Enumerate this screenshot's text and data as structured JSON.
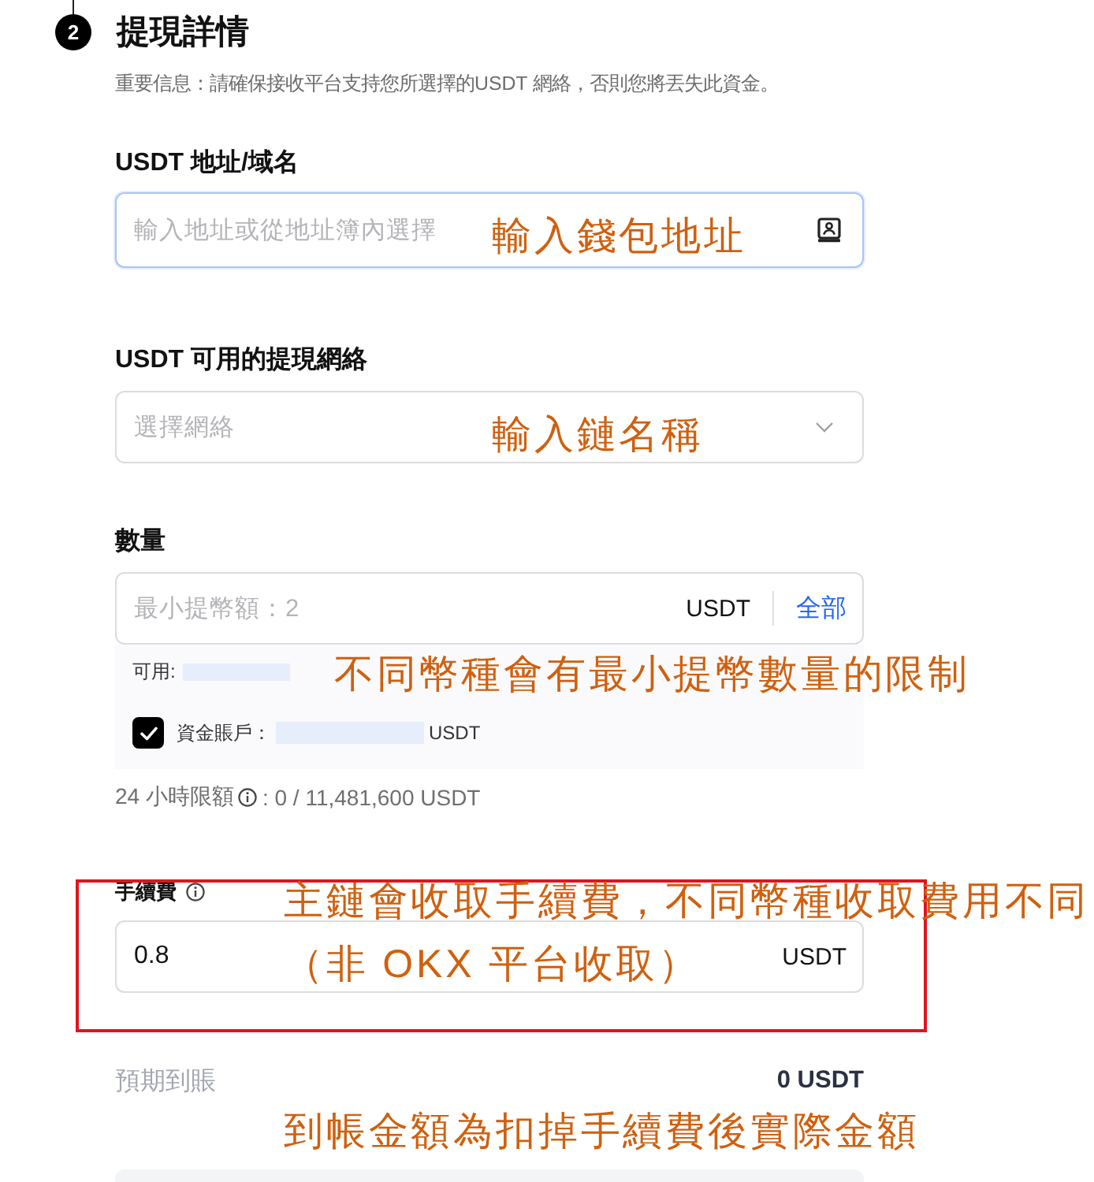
{
  "step": {
    "number": "2",
    "title": "提現詳情"
  },
  "notice": "重要信息：請確保接收平台支持您所選擇的USDT 網絡，否則您將丟失此資金。",
  "address": {
    "label": "USDT 地址/域名",
    "placeholder": "輸入地址或從地址簿內選擇",
    "focused": true,
    "annotation": "輸入錢包地址"
  },
  "network": {
    "label": "USDT 可用的提現網絡",
    "placeholder": "選擇網絡",
    "focused": false,
    "annotation": "輸入鏈名稱"
  },
  "amount": {
    "label": "數量",
    "placeholder": "最小提幣額：2",
    "focused": false,
    "unit": "USDT",
    "max_link": "全部",
    "available": {
      "label": "可用:",
      "redacted": true
    },
    "funding_account": {
      "label": "資金賬戶：",
      "checked": true,
      "redacted": true,
      "unit": "USDT"
    },
    "annotation": "不同幣種會有最小提幣數量的限制"
  },
  "daily_limit": {
    "label": "24 小時限額",
    "value": ": 0 / 11,481,600 USDT"
  },
  "fee": {
    "label": "手續費",
    "value": "0.8",
    "unit": "USDT",
    "focused": false,
    "highlighted": true,
    "annotation": [
      "主鏈會收取手續費，不同幣種收取費用不同",
      "（非 OKX 平台收取）"
    ]
  },
  "expected": {
    "label": "預期到賬",
    "value": "0 USDT",
    "annotation": "到帳金額為扣掉手續費後實際金額"
  }
}
